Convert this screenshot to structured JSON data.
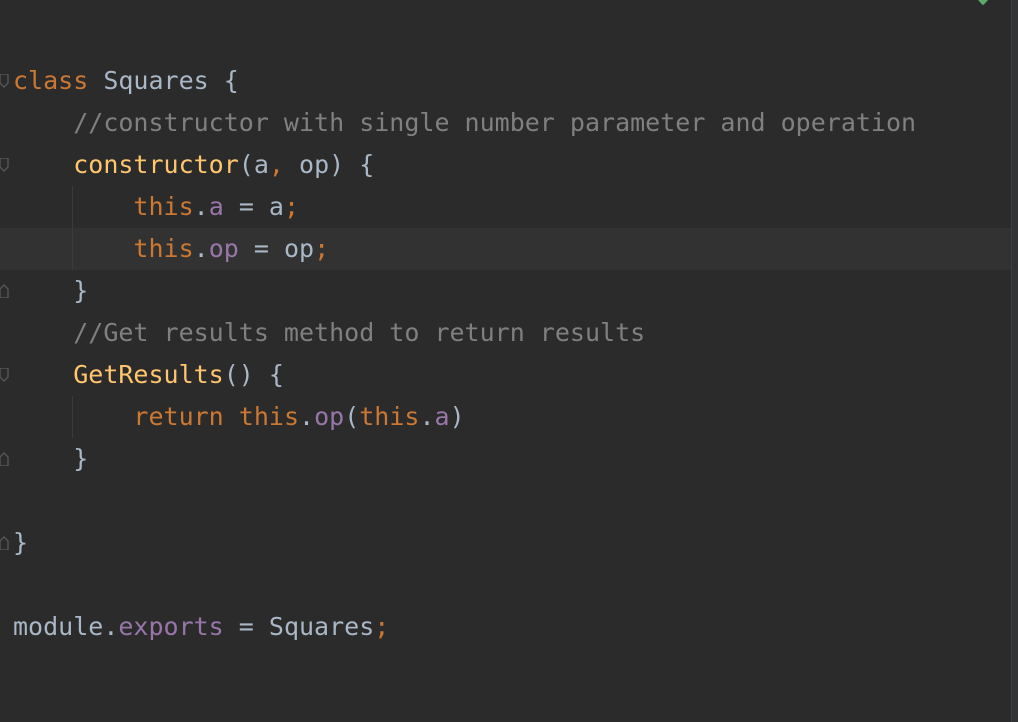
{
  "editor": {
    "language": "JavaScript",
    "status_icon": "inspection-ok-check-icon",
    "colors": {
      "background": "#2b2b2b",
      "keyword": "#cc7832",
      "function": "#ffc66d",
      "comment": "#808080",
      "property": "#9876aa",
      "text": "#a9b7c6",
      "current_line": "#323232",
      "status_ok": "#5daa6c"
    },
    "lines": [
      {
        "tokens": [
          {
            "t": "class",
            "k": "kw"
          },
          {
            "t": " ",
            "k": "plain"
          },
          {
            "t": "Squares",
            "k": "cls"
          },
          {
            "t": " {",
            "k": "plain"
          }
        ]
      },
      {
        "tokens": [
          {
            "t": "    ",
            "k": "plain"
          },
          {
            "t": "//constructor with single number parameter and operation",
            "k": "cmt"
          }
        ]
      },
      {
        "tokens": [
          {
            "t": "    ",
            "k": "plain"
          },
          {
            "t": "constructor",
            "k": "fn"
          },
          {
            "t": "(a",
            "k": "plain"
          },
          {
            "t": ",",
            "k": "punc"
          },
          {
            "t": " op) {",
            "k": "plain"
          }
        ]
      },
      {
        "tokens": [
          {
            "t": "        ",
            "k": "plain"
          },
          {
            "t": "this",
            "k": "kw"
          },
          {
            "t": ".",
            "k": "plain"
          },
          {
            "t": "a",
            "k": "prop"
          },
          {
            "t": " = a",
            "k": "plain"
          },
          {
            "t": ";",
            "k": "punc"
          }
        ]
      },
      {
        "tokens": [
          {
            "t": "        ",
            "k": "plain"
          },
          {
            "t": "this",
            "k": "kw"
          },
          {
            "t": ".",
            "k": "plain"
          },
          {
            "t": "op",
            "k": "prop"
          },
          {
            "t": " = op",
            "k": "plain"
          },
          {
            "t": ";",
            "k": "punc"
          }
        ]
      },
      {
        "tokens": [
          {
            "t": "    }",
            "k": "plain"
          }
        ]
      },
      {
        "tokens": [
          {
            "t": "    ",
            "k": "plain"
          },
          {
            "t": "//Get results method to return results",
            "k": "cmt"
          }
        ]
      },
      {
        "tokens": [
          {
            "t": "    ",
            "k": "plain"
          },
          {
            "t": "GetResults",
            "k": "fn"
          },
          {
            "t": "() {",
            "k": "plain"
          }
        ]
      },
      {
        "tokens": [
          {
            "t": "        ",
            "k": "plain"
          },
          {
            "t": "return",
            "k": "kw"
          },
          {
            "t": " ",
            "k": "plain"
          },
          {
            "t": "this",
            "k": "kw"
          },
          {
            "t": ".",
            "k": "plain"
          },
          {
            "t": "op",
            "k": "prop"
          },
          {
            "t": "(",
            "k": "plain"
          },
          {
            "t": "this",
            "k": "kw"
          },
          {
            "t": ".",
            "k": "plain"
          },
          {
            "t": "a",
            "k": "prop"
          },
          {
            "t": ")",
            "k": "plain"
          }
        ]
      },
      {
        "tokens": [
          {
            "t": "    }",
            "k": "plain"
          }
        ]
      },
      {
        "tokens": []
      },
      {
        "tokens": [
          {
            "t": "}",
            "k": "plain"
          }
        ]
      },
      {
        "tokens": []
      },
      {
        "tokens": [
          {
            "t": "module",
            "k": "plain"
          },
          {
            "t": ".",
            "k": "plain"
          },
          {
            "t": "exports",
            "k": "prop"
          },
          {
            "t": " = Squares",
            "k": "plain"
          },
          {
            "t": ";",
            "k": "punc"
          }
        ]
      }
    ]
  }
}
